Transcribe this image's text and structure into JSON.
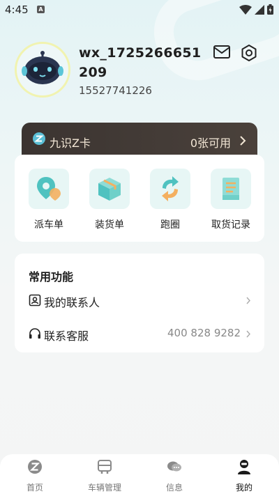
{
  "status_bar": {
    "time": "4:45",
    "notification_badge": "A"
  },
  "profile": {
    "username": "wx_1725266651209",
    "phone": "15527741226"
  },
  "zcard": {
    "name": "九识Z卡",
    "available": "0张可用"
  },
  "quick_actions": [
    {
      "label": "派车单",
      "icon": "map-pin-icon"
    },
    {
      "label": "装货单",
      "icon": "cargo-box-icon"
    },
    {
      "label": "跑圈",
      "icon": "loop-arrows-icon"
    },
    {
      "label": "取货记录",
      "icon": "receipt-icon"
    }
  ],
  "features": {
    "title": "常用功能",
    "items": [
      {
        "label": "我的联系人",
        "value": "",
        "icon": "contacts-icon"
      },
      {
        "label": "联系客服",
        "value": "400 828 9282",
        "icon": "headset-icon"
      }
    ]
  },
  "bottom_nav": {
    "items": [
      {
        "label": "首页",
        "icon": "home-logo-icon"
      },
      {
        "label": "车辆管理",
        "icon": "vehicle-icon"
      },
      {
        "label": "信息",
        "icon": "chat-icon"
      },
      {
        "label": "我的",
        "icon": "profile-icon"
      }
    ],
    "active_index": 3
  },
  "colors": {
    "accent": "#4fc2c0",
    "card_dark": "#3b3431",
    "card_text": "#f3e7d6"
  }
}
